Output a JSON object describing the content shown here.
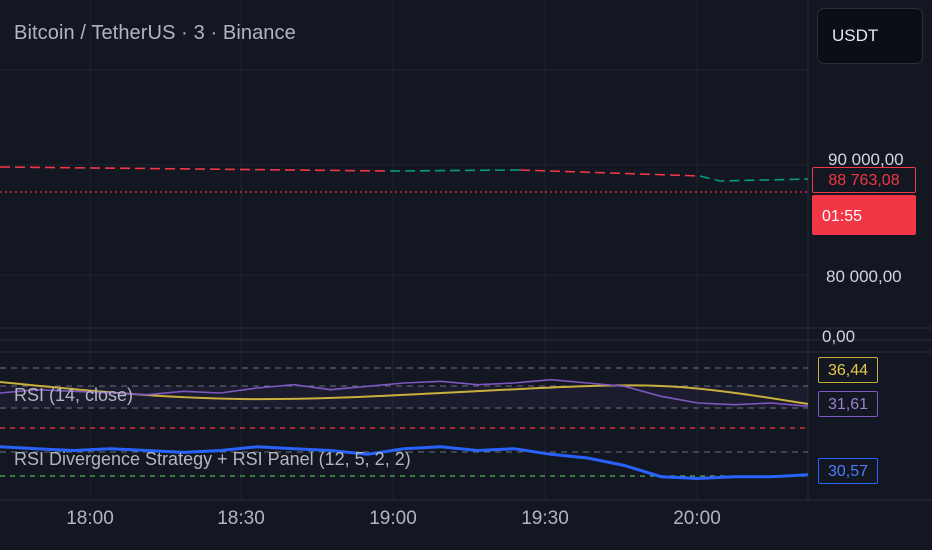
{
  "header": {
    "symbol_title": "Bitcoin / TetherUS · 3 · Binance",
    "currency_button": "USDT"
  },
  "price_axis": {
    "labels": [
      "90 000,00",
      "80 000,00",
      "0,00"
    ],
    "last_price": "88 763,08",
    "countdown": "01:55"
  },
  "indicators": {
    "rsi_label": "RSI (14, close)",
    "rsi_value": "31,61",
    "rsi_ma_value": "36,44",
    "strategy_label": "RSI Divergence Strategy + RSI Panel (12, 5, 2, 2)",
    "strategy_value": "30,57"
  },
  "time_axis": {
    "labels": [
      "18:00",
      "18:30",
      "19:00",
      "19:30",
      "20:00"
    ]
  },
  "colors": {
    "background": "#131722",
    "price_down": "#f23645",
    "price_up": "#089981",
    "rsi_line": "#7e57c2",
    "rsi_ma": "#c9b03c",
    "strategy_line": "#2962ff",
    "overbought": "#f23645",
    "oversold": "#4caf50"
  },
  "chart_data": {
    "type": "line",
    "x_labels": [
      "18:00",
      "18:30",
      "19:00",
      "19:30",
      "20:00"
    ],
    "price_axis_ticks": [
      90000,
      80000
    ],
    "last_price": 88763.08,
    "series": [
      {
        "name": "RSI (14, close)",
        "last": 31.61,
        "values": [
          40,
          42,
          41,
          40,
          39,
          41,
          40,
          43,
          45,
          42,
          44,
          46,
          47,
          45,
          46,
          48,
          46,
          44,
          38,
          34,
          33,
          34,
          32
        ]
      },
      {
        "name": "RSI Divergence Strategy + RSI Panel (12, 5, 2, 2)",
        "last": 30.57,
        "values": [
          46,
          45,
          44,
          45,
          44,
          43,
          44,
          46,
          45,
          44,
          42,
          45,
          46,
          44,
          45,
          42,
          40,
          36,
          30,
          29,
          30,
          30,
          31
        ]
      }
    ]
  }
}
